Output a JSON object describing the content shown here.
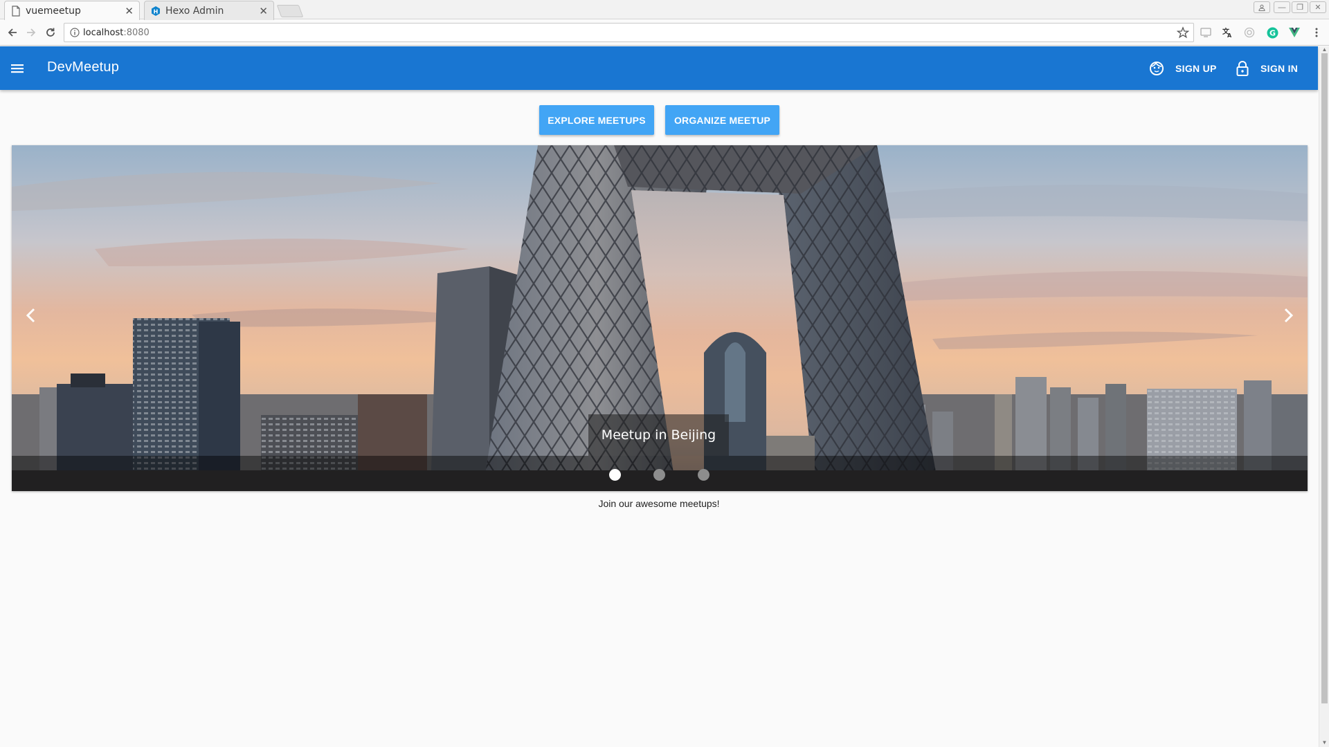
{
  "browser": {
    "tabs": [
      {
        "title": "vuemeetup",
        "active": true
      },
      {
        "title": "Hexo Admin",
        "active": false
      }
    ],
    "url_host": "localhost",
    "url_port": ":8080"
  },
  "app": {
    "brand": "DevMeetup",
    "nav": {
      "signup_label": "SIGN UP",
      "signin_label": "SIGN IN"
    },
    "actions": {
      "explore_label": "EXPLORE MEETUPS",
      "organize_label": "ORGANIZE MEETUP"
    },
    "carousel": {
      "caption": "Meetup in Beijing",
      "slide_count": 3,
      "active_slide": 1
    },
    "tagline": "Join our awesome meetups!"
  },
  "colors": {
    "primary": "#1976d2",
    "button": "#42a5f5",
    "background": "#fafafa"
  },
  "icons": {
    "menu": "menu-icon",
    "signup": "face-icon",
    "signin": "lock-icon",
    "prev": "chevron-left-icon",
    "next": "chevron-right-icon"
  }
}
